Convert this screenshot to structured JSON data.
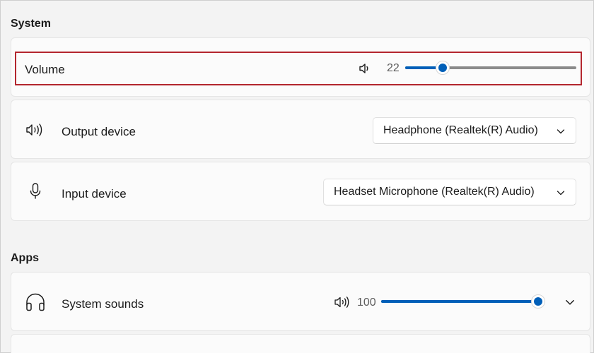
{
  "sections": {
    "system_title": "System",
    "apps_title": "Apps"
  },
  "system": {
    "volume": {
      "label": "Volume",
      "value_text": "22",
      "value_fraction": 0.22,
      "icon": "speaker-low-icon"
    },
    "output_device": {
      "label": "Output device",
      "icon": "speaker-high-icon",
      "selected": "Headphone (Realtek(R) Audio)"
    },
    "input_device": {
      "label": "Input device",
      "icon": "microphone-icon",
      "selected": "Headset Microphone (Realtek(R) Audio)"
    }
  },
  "apps": {
    "system_sounds": {
      "label": "System sounds",
      "icon": "headphones-icon",
      "value_text": "100",
      "value_fraction": 1.0,
      "volume_icon": "speaker-high-icon"
    }
  },
  "colors": {
    "accent": "#005fb8",
    "highlight_border": "#b3262e",
    "track": "#8a8a8a",
    "background": "#f3f3f3",
    "card": "#fbfbfb"
  }
}
